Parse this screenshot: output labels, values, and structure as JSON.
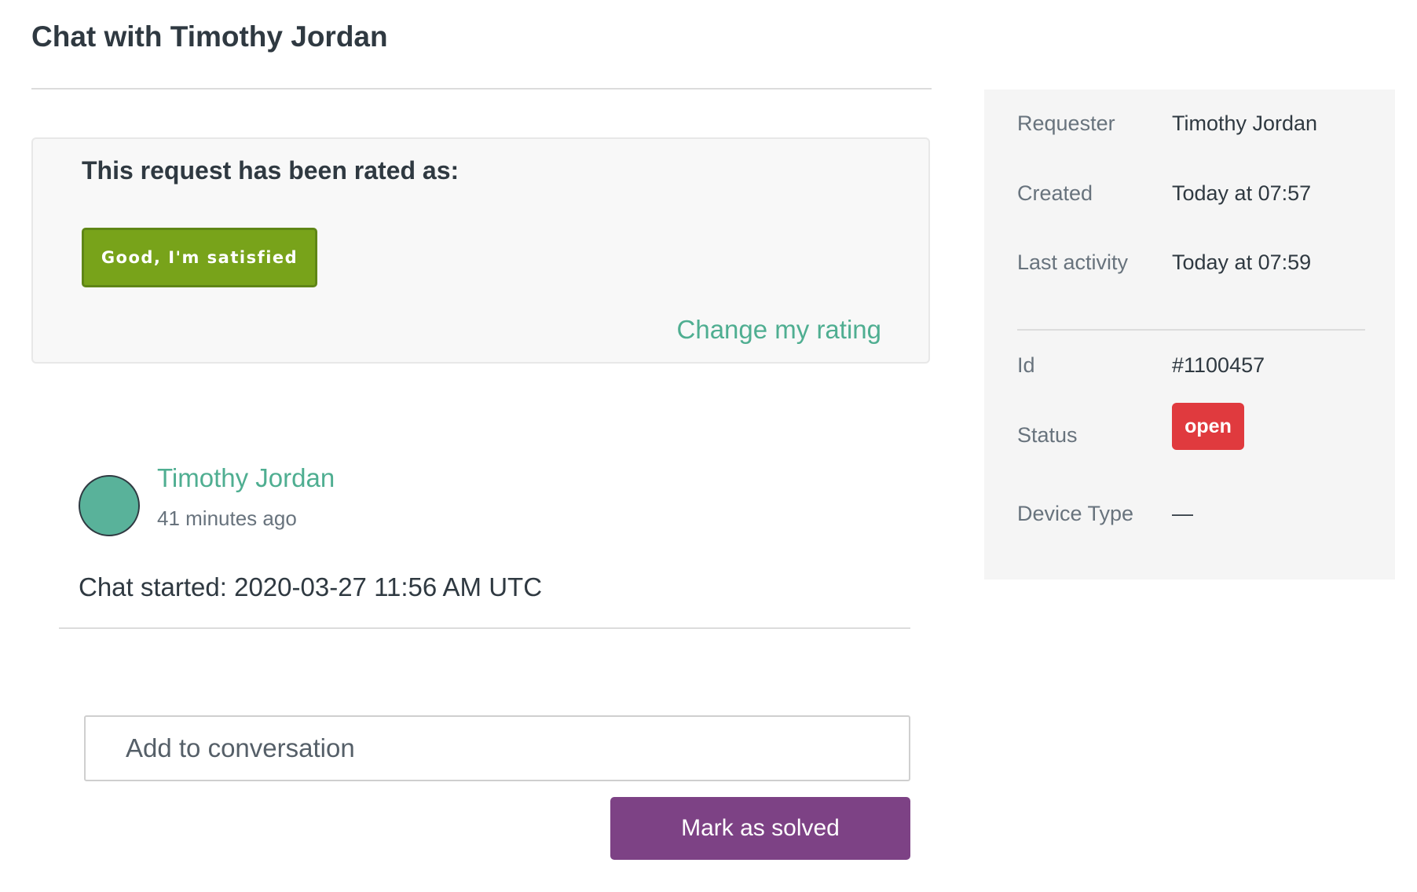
{
  "header": {
    "title": "Chat with Timothy Jordan"
  },
  "rating": {
    "heading": "This request has been rated as:",
    "value": "Good, I'm satisfied",
    "change_link": "Change my rating",
    "badge_color": "#78a31a"
  },
  "conversation": {
    "author": "Timothy Jordan",
    "time_ago": "41 minutes ago",
    "message": "Chat started: 2020-03-27 11:56 AM UTC",
    "avatar_color": "#59b29a"
  },
  "reply": {
    "placeholder": "Add to conversation",
    "submit_label": "Mark as solved",
    "submit_color": "#7d4285"
  },
  "details": {
    "requester_label": "Requester",
    "requester_value": "Timothy Jordan",
    "created_label": "Created",
    "created_value": "Today at 07:57",
    "last_activity_label": "Last activity",
    "last_activity_value": "Today at 07:59",
    "id_label": "Id",
    "id_value": "#1100457",
    "status_label": "Status",
    "status_value": "open",
    "status_color": "#e03a3e",
    "device_type_label": "Device Type",
    "device_type_value": "—"
  }
}
